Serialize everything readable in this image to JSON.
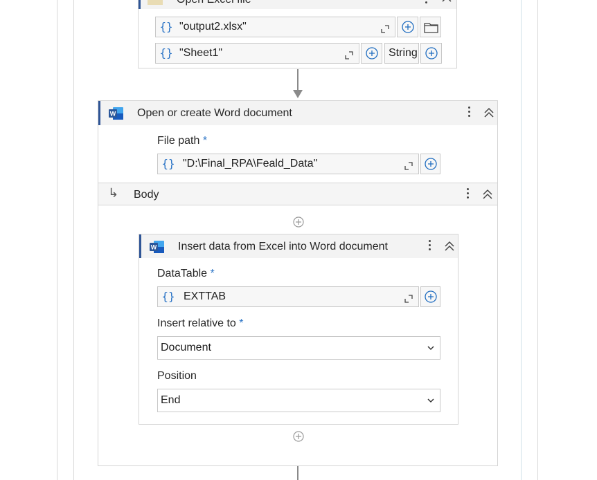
{
  "excel_card": {
    "title": "Open Excel file",
    "file_value": "\"output2.xlsx\"",
    "sheet_value": "\"Sheet1\"",
    "type_value": "String"
  },
  "word_card": {
    "title": "Open or create Word document",
    "file_path_label": "File path",
    "required_mark": "*",
    "file_path_value": "\"D:\\Final_RPA\\Feald_Data\"",
    "body_label": "Body"
  },
  "insert_card": {
    "title": "Insert data from Excel into Word document",
    "datatable_label": "DataTable",
    "datatable_value": "EXTTAB",
    "insert_relative_label": "Insert relative to",
    "insert_relative_value": "Document",
    "position_label": "Position",
    "position_value": "End",
    "required_mark": "*"
  },
  "icons": {
    "word": "word-app-icon",
    "excel": "excel-app-icon",
    "brace": "{}",
    "body_arrow": "↳"
  },
  "colors": {
    "accent": "#2f5596",
    "brace": "#2b74c6",
    "word_blue": "#2b579a"
  }
}
